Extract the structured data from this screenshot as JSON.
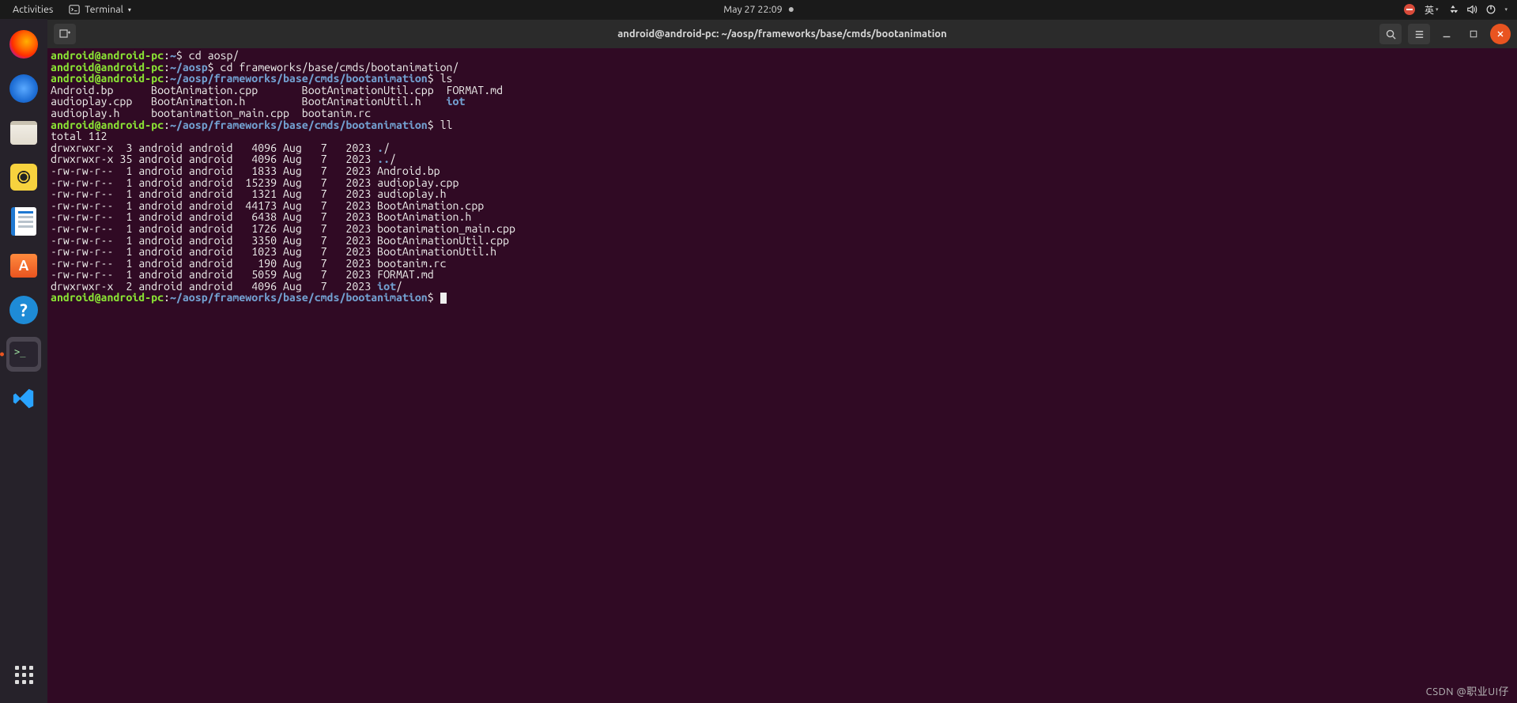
{
  "panel": {
    "activities": "Activities",
    "app_label": "Terminal",
    "clock": "May 27  22:09",
    "ime": "英"
  },
  "dock": {
    "items": [
      {
        "name": "firefox",
        "active": false
      },
      {
        "name": "thunderbird",
        "active": false
      },
      {
        "name": "files",
        "active": false
      },
      {
        "name": "rhythmbox",
        "active": false
      },
      {
        "name": "writer",
        "active": false
      },
      {
        "name": "software",
        "active": false
      },
      {
        "name": "help",
        "active": false
      },
      {
        "name": "terminal",
        "active": true
      },
      {
        "name": "vscode",
        "active": false
      }
    ]
  },
  "window": {
    "title": "android@android-pc: ~/aosp/frameworks/base/cmds/bootanimation"
  },
  "terminal": {
    "user_host": "android@android-pc",
    "sep": ":",
    "tilde": "~",
    "dollar": "$",
    "prompts": {
      "p1_path": "~",
      "p1_cmd": "cd aosp/",
      "p2_path": "~/aosp",
      "p2_cmd": "cd frameworks/base/cmds/bootanimation/",
      "p3_path": "~/aosp/frameworks/base/cmds/bootanimation",
      "p3_cmd": "ls",
      "p4_path": "~/aosp/frameworks/base/cmds/bootanimation",
      "p4_cmd": "ll",
      "p5_path": "~/aosp/frameworks/base/cmds/bootanimation",
      "p5_cmd": ""
    },
    "ls_columns": [
      [
        "Android.bp",
        "audioplay.cpp",
        "audioplay.h"
      ],
      [
        "BootAnimation.cpp",
        "BootAnimation.h",
        "bootanimation_main.cpp"
      ],
      [
        "BootAnimationUtil.cpp",
        "BootAnimationUtil.h",
        "bootanim.rc"
      ],
      [
        "FORMAT.md",
        "iot",
        ""
      ]
    ],
    "ls_row1": "Android.bp      BootAnimation.cpp       BootAnimationUtil.cpp  FORMAT.md",
    "ls_row2_pre": "audioplay.cpp   BootAnimation.h         BootAnimationUtil.h    ",
    "ls_row2_dir": "iot",
    "ls_row3": "audioplay.h     bootanimation_main.cpp  bootanim.rc",
    "ll_total": "total 112",
    "ll": [
      {
        "perm": "drwxrwxr-x",
        "n": " 3",
        "o": "android",
        "g": "android",
        "s": "  4096",
        "d": "Aug   7   2023",
        "name": ".",
        "dir": true,
        "slash": "/"
      },
      {
        "perm": "drwxrwxr-x",
        "n": "35",
        "o": "android",
        "g": "android",
        "s": "  4096",
        "d": "Aug   7   2023",
        "name": "..",
        "dir": true,
        "slash": "/"
      },
      {
        "perm": "-rw-rw-r--",
        "n": " 1",
        "o": "android",
        "g": "android",
        "s": "  1833",
        "d": "Aug   7   2023",
        "name": "Android.bp",
        "dir": false,
        "slash": ""
      },
      {
        "perm": "-rw-rw-r--",
        "n": " 1",
        "o": "android",
        "g": "android",
        "s": " 15239",
        "d": "Aug   7   2023",
        "name": "audioplay.cpp",
        "dir": false,
        "slash": ""
      },
      {
        "perm": "-rw-rw-r--",
        "n": " 1",
        "o": "android",
        "g": "android",
        "s": "  1321",
        "d": "Aug   7   2023",
        "name": "audioplay.h",
        "dir": false,
        "slash": ""
      },
      {
        "perm": "-rw-rw-r--",
        "n": " 1",
        "o": "android",
        "g": "android",
        "s": " 44173",
        "d": "Aug   7   2023",
        "name": "BootAnimation.cpp",
        "dir": false,
        "slash": ""
      },
      {
        "perm": "-rw-rw-r--",
        "n": " 1",
        "o": "android",
        "g": "android",
        "s": "  6438",
        "d": "Aug   7   2023",
        "name": "BootAnimation.h",
        "dir": false,
        "slash": ""
      },
      {
        "perm": "-rw-rw-r--",
        "n": " 1",
        "o": "android",
        "g": "android",
        "s": "  1726",
        "d": "Aug   7   2023",
        "name": "bootanimation_main.cpp",
        "dir": false,
        "slash": ""
      },
      {
        "perm": "-rw-rw-r--",
        "n": " 1",
        "o": "android",
        "g": "android",
        "s": "  3350",
        "d": "Aug   7   2023",
        "name": "BootAnimationUtil.cpp",
        "dir": false,
        "slash": ""
      },
      {
        "perm": "-rw-rw-r--",
        "n": " 1",
        "o": "android",
        "g": "android",
        "s": "  1023",
        "d": "Aug   7   2023",
        "name": "BootAnimationUtil.h",
        "dir": false,
        "slash": ""
      },
      {
        "perm": "-rw-rw-r--",
        "n": " 1",
        "o": "android",
        "g": "android",
        "s": "   190",
        "d": "Aug   7   2023",
        "name": "bootanim.rc",
        "dir": false,
        "slash": ""
      },
      {
        "perm": "-rw-rw-r--",
        "n": " 1",
        "o": "android",
        "g": "android",
        "s": "  5059",
        "d": "Aug   7   2023",
        "name": "FORMAT.md",
        "dir": false,
        "slash": ""
      },
      {
        "perm": "drwxrwxr-x",
        "n": " 2",
        "o": "android",
        "g": "android",
        "s": "  4096",
        "d": "Aug   7   2023",
        "name": "iot",
        "dir": true,
        "slash": "/"
      }
    ]
  },
  "watermark": "CSDN @职业UI仔"
}
